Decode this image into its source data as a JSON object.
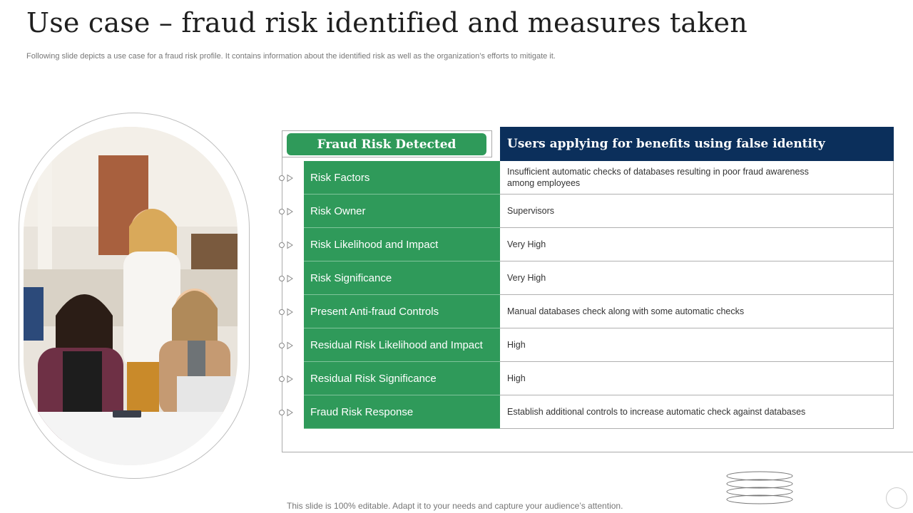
{
  "slide": {
    "title": "Use case – fraud risk identified and measures taken",
    "subtitle": "Following slide depicts a use case for a fraud risk profile. It contains information about the identified risk as well as the organization’s efforts to mitigate it.",
    "footer": "This slide is 100% editable. Adapt it to your needs and capture your audience’s attention."
  },
  "table": {
    "left_header": "Fraud Risk Detected",
    "right_header": "Users applying for benefits using false identity",
    "rows": [
      {
        "label": "Risk Factors",
        "value": "Insufficient automatic checks of databases resulting in poor fraud awareness among employees"
      },
      {
        "label": "Risk Owner",
        "value": "Supervisors"
      },
      {
        "label": "Risk Likelihood and Impact",
        "value": "Very High"
      },
      {
        "label": "Risk Significance",
        "value": "Very High"
      },
      {
        "label": "Present Anti-fraud Controls",
        "value": "Manual databases check along with some automatic checks"
      },
      {
        "label": "Residual Risk Likelihood and Impact",
        "value": "High"
      },
      {
        "label": "Residual Risk Significance",
        "value": "High"
      },
      {
        "label": "Fraud Risk Response",
        "value": "Establish additional controls to increase automatic check against databases"
      }
    ]
  },
  "colors": {
    "green": "#2f9a5a",
    "navy": "#0b2f5b"
  },
  "icons": [
    "row-bullet-icon",
    "coil-decoration-icon"
  ]
}
